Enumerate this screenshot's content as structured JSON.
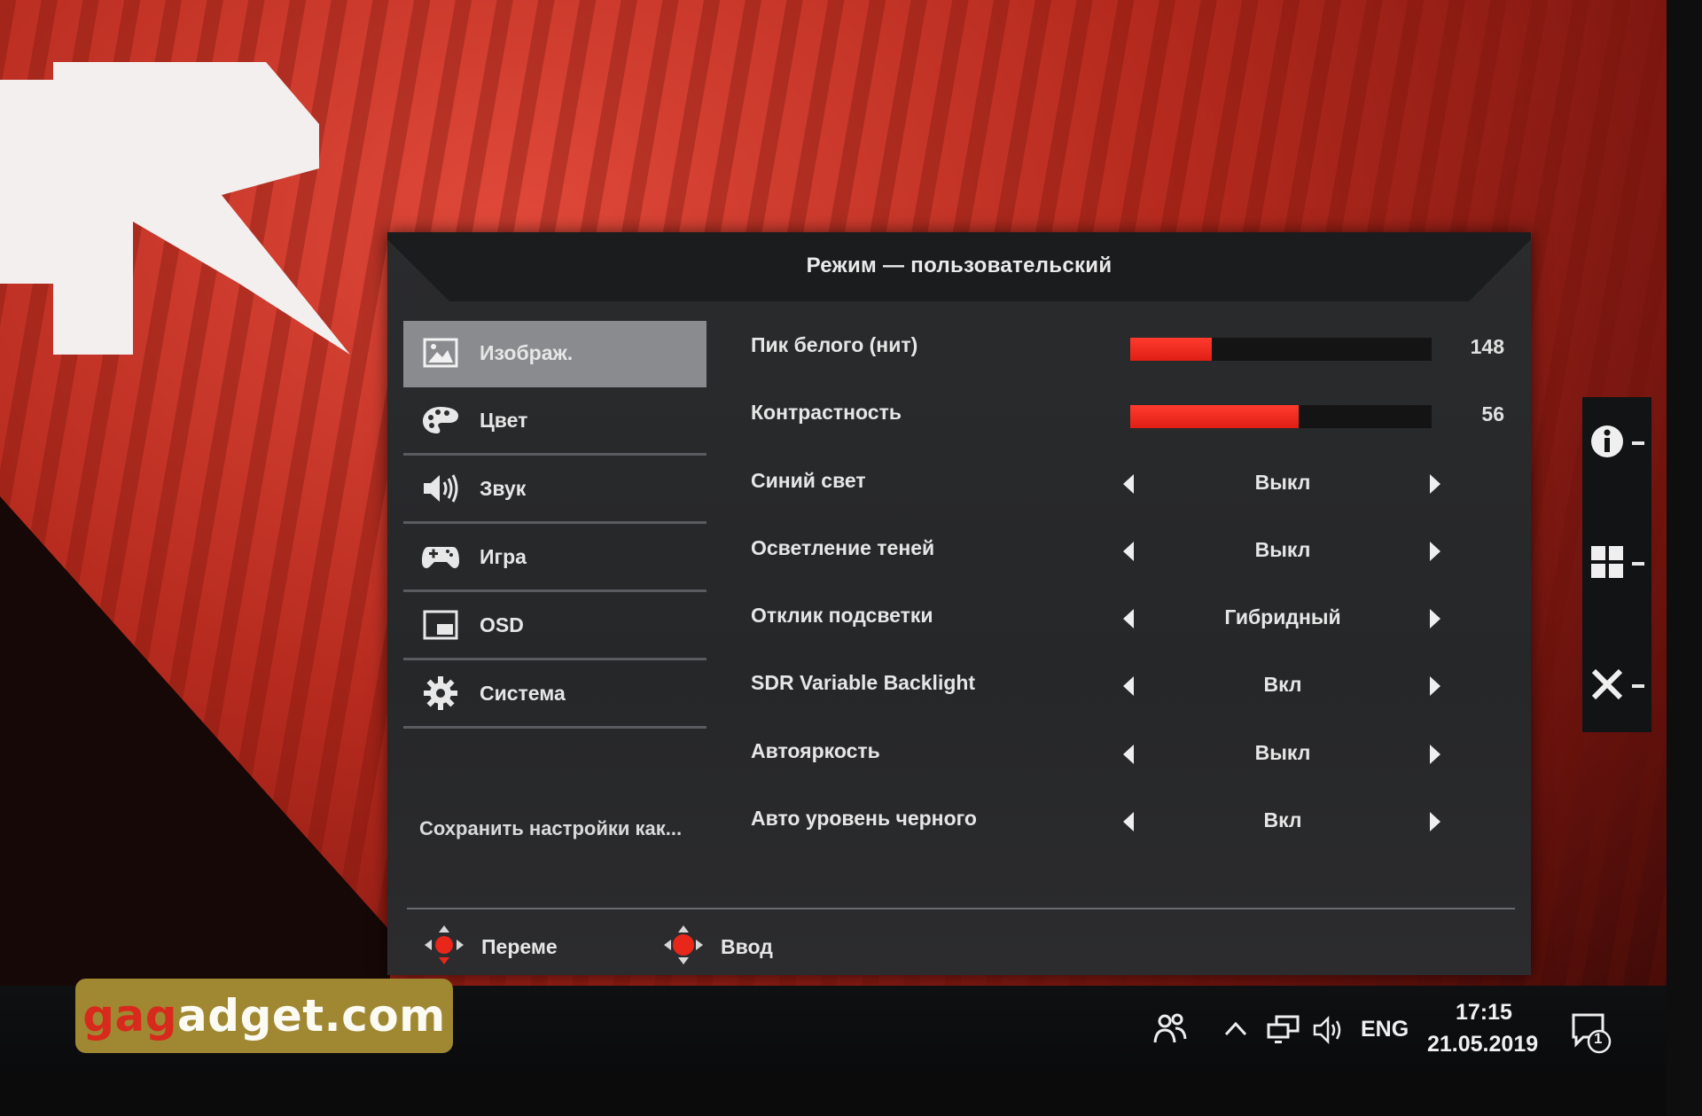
{
  "wallpaper": {
    "accent": "#c9301f"
  },
  "osd": {
    "title": "Режим — пользовательский",
    "nav": [
      {
        "label": "Изображ.",
        "icon": "image-icon",
        "active": true
      },
      {
        "label": "Цвет",
        "icon": "palette-icon",
        "active": false
      },
      {
        "label": "Звук",
        "icon": "speaker-icon",
        "active": false
      },
      {
        "label": "Игра",
        "icon": "gamepad-icon",
        "active": false
      },
      {
        "label": "OSD",
        "icon": "osd-window-icon",
        "active": false
      },
      {
        "label": "Система",
        "icon": "gear-icon",
        "active": false
      }
    ],
    "save_label": "Сохранить настройки как...",
    "settings": [
      {
        "label": "Пик белого (нит)",
        "type": "slider",
        "value": "148",
        "fill": 0.27
      },
      {
        "label": "Контрастность",
        "type": "slider",
        "value": "56",
        "fill": 0.56
      },
      {
        "label": "Синий свет",
        "type": "option",
        "value": "Выкл"
      },
      {
        "label": "Осветление теней",
        "type": "option",
        "value": "Выкл"
      },
      {
        "label": "Отклик подсветки",
        "type": "option",
        "value": "Гибридный"
      },
      {
        "label": "SDR Variable Backlight",
        "type": "option",
        "value": "Вкл"
      },
      {
        "label": "Автояркость",
        "type": "option",
        "value": "Выкл"
      },
      {
        "label": "Авто уровень черного",
        "type": "option",
        "value": "Вкл"
      }
    ],
    "hints": {
      "move": "Переме",
      "enter": "Ввод"
    },
    "accent_color": "#e8261a"
  },
  "quickbar": {
    "icons": [
      "info-icon",
      "grid-icon",
      "close-icon"
    ]
  },
  "watermark": {
    "prefix": "ga",
    "middle": "g",
    "suffix": "adget.com"
  },
  "taskbar": {
    "language": "ENG",
    "time": "17:15",
    "date": "21.05.2019",
    "notification_count": "1"
  }
}
